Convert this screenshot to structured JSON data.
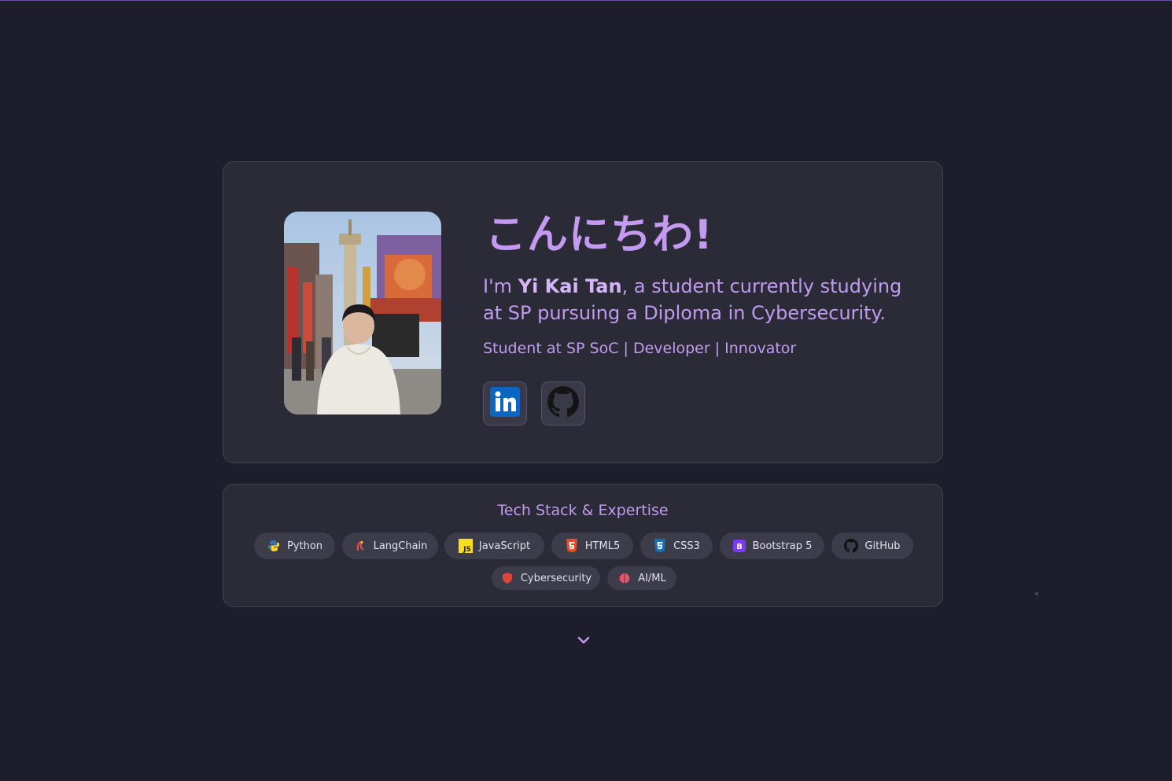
{
  "hero": {
    "greeting": "こんにちわ!",
    "intro_prefix": "I'm ",
    "name": "Yi Kai Tan",
    "intro_suffix": ", a student currently studying at SP pursuing a Diploma in Cybersecurity.",
    "tagline": "Student at SP SoC | Developer | Innovator",
    "socials": [
      {
        "icon": "linkedin-icon"
      },
      {
        "icon": "github-icon"
      }
    ]
  },
  "tech_stack": {
    "title": "Tech Stack & Expertise",
    "items": [
      {
        "label": "Python",
        "icon": "python-icon"
      },
      {
        "label": "LangChain",
        "icon": "langchain-icon"
      },
      {
        "label": "JavaScript",
        "icon": "javascript-icon"
      },
      {
        "label": "HTML5",
        "icon": "html5-icon"
      },
      {
        "label": "CSS3",
        "icon": "css3-icon"
      },
      {
        "label": "Bootstrap 5",
        "icon": "bootstrap-icon"
      },
      {
        "label": "GitHub",
        "icon": "github-icon"
      },
      {
        "label": "Cybersecurity",
        "icon": "shield-icon"
      },
      {
        "label": "AI/ML",
        "icon": "brain-icon"
      }
    ]
  },
  "colors": {
    "background": "#1e1d2b",
    "card": "#2b2a37",
    "accent": "#c49af0",
    "pill": "#3d3c4b"
  },
  "scroll_indicator": {
    "icon": "chevron-down-icon"
  }
}
